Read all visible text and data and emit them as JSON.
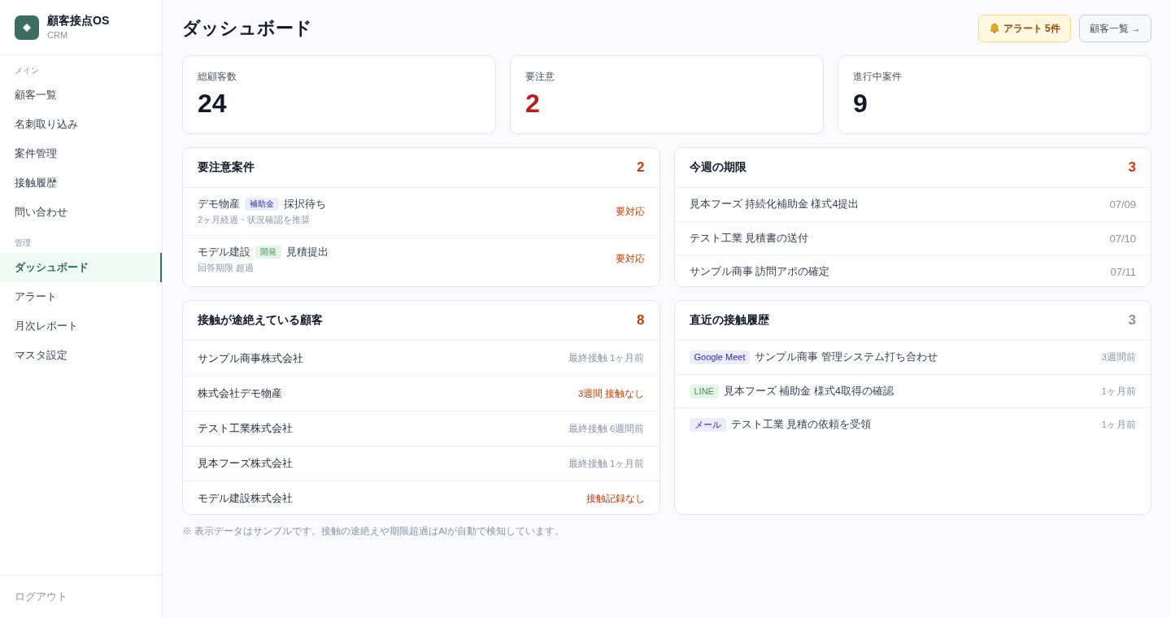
{
  "sidebar": {
    "app_name": "顧客接点OS",
    "app_subtitle": "CRM",
    "sections": [
      {
        "label": "メイン",
        "items": [
          {
            "label": "顧客一覧",
            "selected": false
          },
          {
            "label": "名刺取り込み",
            "selected": false
          },
          {
            "label": "案件管理",
            "selected": false
          },
          {
            "label": "接触履歴",
            "selected": false
          },
          {
            "label": "問い合わせ",
            "selected": false
          }
        ]
      },
      {
        "label": "管理",
        "items": [
          {
            "label": "ダッシュボード",
            "selected": true
          },
          {
            "label": "アラート",
            "selected": false
          },
          {
            "label": "月次レポート",
            "selected": false
          },
          {
            "label": "マスタ設定",
            "selected": false
          }
        ]
      }
    ],
    "logout": "ログアウト"
  },
  "header": {
    "title": "ダッシュボード",
    "buttons": [
      {
        "kind": "alert",
        "label": "アラート 5件"
      },
      {
        "kind": "link",
        "label": "顧客一覧 →"
      }
    ]
  },
  "stats": [
    {
      "label": "総顧客数",
      "value": "24",
      "alert": false
    },
    {
      "label": "要注意",
      "value": "2",
      "alert": true
    },
    {
      "label": "進行中案件",
      "value": "9",
      "alert": false
    }
  ],
  "panels": [
    {
      "kind": "attention",
      "title": "要注意案件",
      "count": "2",
      "count_alert": true,
      "items": [
        {
          "company": "デモ物産",
          "tag": {
            "label": "補助金",
            "color": "#ececfd"
          },
          "subject": "採択待ち",
          "note": "2ヶ月経過・状況確認を推奨",
          "status": "要対応"
        },
        {
          "company": "モデル建設",
          "tag": {
            "label": "開発",
            "color": "#e4f4e7"
          },
          "subject": "見積提出",
          "note": "回答期限 超過",
          "status": "要対応"
        }
      ]
    },
    {
      "kind": "deadlines",
      "title": "今週の期限",
      "count": "3",
      "count_alert": true,
      "items": [
        {
          "title": "見本フーズ 持続化補助金 様式4提出",
          "date": "07/09"
        },
        {
          "title": "テスト工業 見積書の送付",
          "date": "07/10"
        },
        {
          "title": "サンプル商事 訪問アポの確定",
          "date": "07/11"
        }
      ]
    },
    {
      "kind": "stale",
      "title": "接触が途絶えている顧客",
      "count": "8",
      "count_alert": true,
      "items": [
        {
          "name": "サンプル商事株式会社",
          "last_contact": "最終接触 1ヶ月前",
          "alert": false
        },
        {
          "name": "株式会社デモ物産",
          "last_contact": "3週間 接触なし",
          "alert": true
        },
        {
          "name": "テスト工業株式会社",
          "last_contact": "最終接触 6週間前",
          "alert": false
        },
        {
          "name": "見本フーズ株式会社",
          "last_contact": "最終接触 1ヶ月前",
          "alert": false
        },
        {
          "name": "モデル建設株式会社",
          "last_contact": "接触記録なし",
          "alert": true
        }
      ]
    },
    {
      "kind": "recent",
      "title": "直近の接触履歴",
      "count": "3",
      "count_alert": false,
      "items": [
        {
          "channel": {
            "label": "Google Meet",
            "color": "#ececfd"
          },
          "text": "サンプル商事 管理システム打ち合わせ",
          "ago": "3週間前"
        },
        {
          "channel": {
            "label": "LINE",
            "color": "#e4f4e7"
          },
          "text": "見本フーズ 補助金 様式4取得の確認",
          "ago": "1ヶ月前"
        },
        {
          "channel": {
            "label": "メール",
            "color": "#ececfd"
          },
          "text": "テスト工業 見積の依頼を受領",
          "ago": "1ヶ月前"
        }
      ]
    }
  ],
  "footnote": "※ 表示データはサンプルです。接触の途絶えや期限超過はAIが自動で検知しています。"
}
